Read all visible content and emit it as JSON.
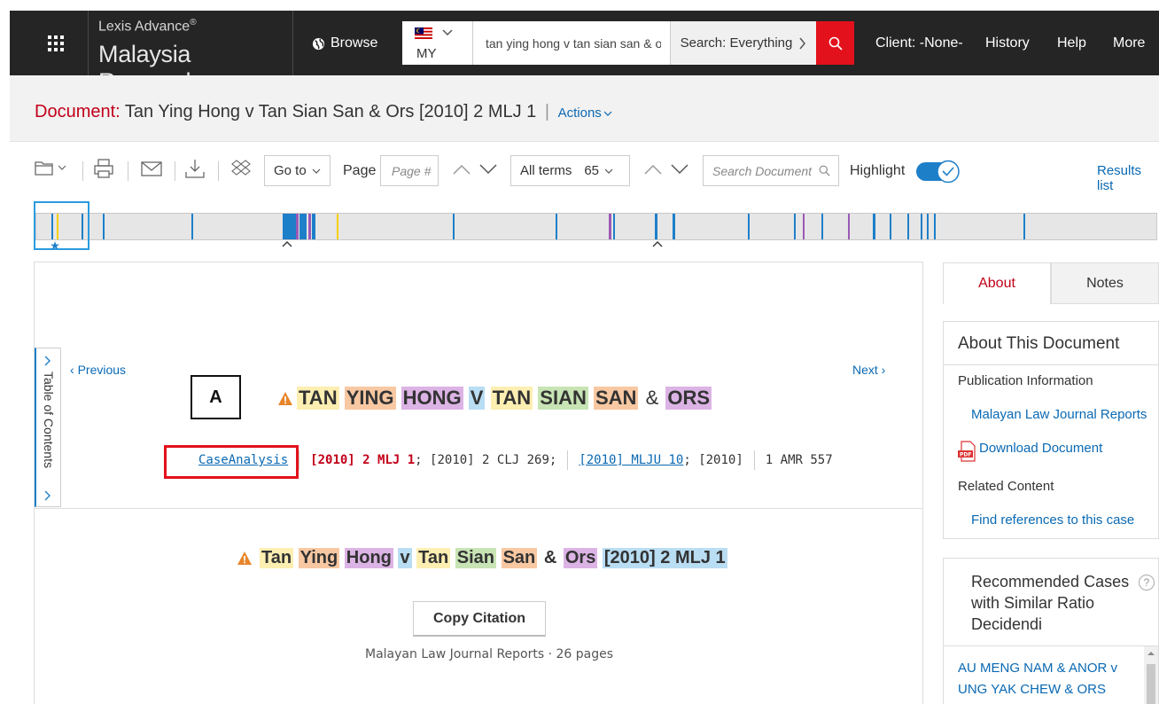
{
  "header": {
    "brand_top": "Lexis Advance",
    "brand_reg": "®",
    "brand_bottom": "Malaysia Research",
    "browse_label": "Browse",
    "country_code": "MY",
    "search_value": "tan ying hong v tan sian san & o",
    "search_scope": "Search: Everything",
    "nav": {
      "client": "Client: -None-",
      "history": "History",
      "help": "Help",
      "more": "More"
    }
  },
  "document": {
    "label": "Document:",
    "title": "Tan Ying Hong v Tan Sian San & Ors [2010] 2 MLJ 1",
    "actions_label": "Actions"
  },
  "toolbar": {
    "goto_label": "Go to",
    "page_label": "Page",
    "page_placeholder": "Page #",
    "terms_label": "All terms",
    "terms_count": "65",
    "search_doc_placeholder": "Search Document",
    "highlight_label": "Highlight",
    "highlight_on": true,
    "results_list": "Results list"
  },
  "hitmap_colors": {
    "blue": "#1e7fc9",
    "yellow": "#f5d000",
    "purple": "#9b59b6",
    "orange": "#f0a050"
  },
  "panel": {
    "toc_label": "Table of Contents",
    "previous": "Previous",
    "next": "Next",
    "annotation_label": "A",
    "case_title_words": [
      {
        "text": "TAN",
        "hl": "c1"
      },
      {
        "text": "YING",
        "hl": "c2"
      },
      {
        "text": "HONG",
        "hl": "c3"
      },
      {
        "text": "V",
        "hl": "c4"
      },
      {
        "text": "TAN",
        "hl": "c1"
      },
      {
        "text": "SIAN",
        "hl": "c5"
      },
      {
        "text": "SAN",
        "hl": "c2"
      },
      {
        "text": "&",
        "hl": ""
      },
      {
        "text": "ORS",
        "hl": "c3"
      }
    ],
    "citations": {
      "case_analysis": "CaseAnalysis",
      "mlj": "[2010] 2 MLJ 1",
      "clj": "; [2010] 2 CLJ 269;",
      "mlju": "[2010] MLJU 10",
      "mlju_rest": "; [2010]",
      "amr": "1 AMR 557"
    },
    "case_title2_words": [
      {
        "text": "Tan",
        "hl": "c1"
      },
      {
        "text": "Ying",
        "hl": "c2"
      },
      {
        "text": "Hong",
        "hl": "c3"
      },
      {
        "text": "v",
        "hl": "c4"
      },
      {
        "text": "Tan",
        "hl": "c1"
      },
      {
        "text": "Sian",
        "hl": "c5"
      },
      {
        "text": "San",
        "hl": "c2"
      },
      {
        "text": "&",
        "hl": ""
      },
      {
        "text": "Ors",
        "hl": "c3"
      },
      {
        "text": "[2010] 2 MLJ 1",
        "hl": "c4"
      }
    ],
    "copy_citation": "Copy Citation",
    "publication_line": "Malayan Law Journal Reports · 26 pages"
  },
  "sidebar": {
    "tab_about": "About",
    "tab_notes": "Notes",
    "about_heading": "About This Document",
    "publication_info": "Publication Information",
    "mljr_link": "Malayan Law Journal Reports",
    "download_link": "Download Document",
    "related_content": "Related Content",
    "find_refs_link": "Find references to this case",
    "recommended_title": "Recommended Cases with Similar Ratio Decidendi",
    "recommended_help": "?",
    "recommended_item": "AU MENG NAM & ANOR v UNG YAK CHEW & ORS"
  }
}
